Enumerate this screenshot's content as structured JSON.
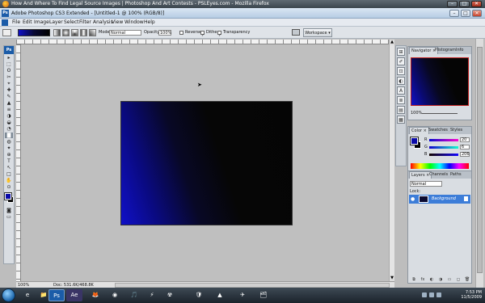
{
  "browser": {
    "title": "How And Where To Find Legal Source Images | Photoshop And Art Contests - PSLEyes.com - Mozilla Firefox",
    "controls": {
      "minimize": "–",
      "maximize": "□",
      "close": "✕"
    }
  },
  "photoshop": {
    "title": "Adobe Photoshop CS3 Extended - [Untitled-1 @ 100% (RGB/8)]",
    "logo": "Ps",
    "controls": {
      "minimize": "–",
      "maximize": "□",
      "close": "✕"
    }
  },
  "menu": [
    "File",
    "Edit",
    "Image",
    "Layer",
    "Select",
    "Filter",
    "Analysis",
    "View",
    "Window",
    "Help"
  ],
  "options": {
    "mode_label": "Mode:",
    "mode_value": "Normal",
    "opacity_label": "Opacity:",
    "opacity_value": "100%",
    "reverse_label": "Reverse",
    "dither_label": "Dither",
    "transparency_label": "Transparency",
    "workspace_label": "Workspace ▾"
  },
  "tools": [
    "▸",
    "⬚",
    "ʘ",
    "✂",
    "⌖",
    "✚",
    "✎",
    "▲",
    "≡",
    "◑",
    "◒",
    "◔",
    "▇",
    "◍",
    "✦",
    "⊕",
    "T",
    "↖",
    "□",
    "✋",
    "⊙"
  ],
  "colors": {
    "foreground": "#0a0aa8",
    "background": "#000000",
    "accent_selection": "#3d7dd8"
  },
  "document": {
    "status_zoom": "100%",
    "status_doc": "Doc: 531.6K/468.8K",
    "gradient": "blue-to-black diagonal gradient"
  },
  "panels": {
    "navigator_tabs": [
      "Navigator ×",
      "Histogram",
      "Info"
    ],
    "navigator_zoom": "100%",
    "color_tabs": [
      "Color ×",
      "Swatches",
      "Styles"
    ],
    "color_rows": [
      {
        "label": "R",
        "value": "20"
      },
      {
        "label": "G",
        "value": "6"
      },
      {
        "label": "B",
        "value": "206"
      }
    ],
    "layers_tabs": [
      "Layers ×",
      "Channels",
      "Paths"
    ],
    "blend_mode": "Normal",
    "lock_label": "Lock:",
    "layer_name": "Background",
    "layer_buttons": [
      "⧉",
      "fx",
      "◐",
      "◑",
      "▭",
      "◻",
      "🗑"
    ]
  },
  "dock_icons": [
    "⊞",
    "✐",
    "⊡",
    "◐",
    "A",
    "≣",
    "▤",
    "▦"
  ],
  "taskbar": {
    "apps": [
      "e",
      "📁",
      "Ps",
      "Ae",
      "🦊",
      "◉",
      "🎵",
      "⚡",
      "☢",
      "🛡",
      "▲",
      "✈",
      "🗂"
    ],
    "time": "7:53 PM",
    "date": "11/5/2009"
  }
}
